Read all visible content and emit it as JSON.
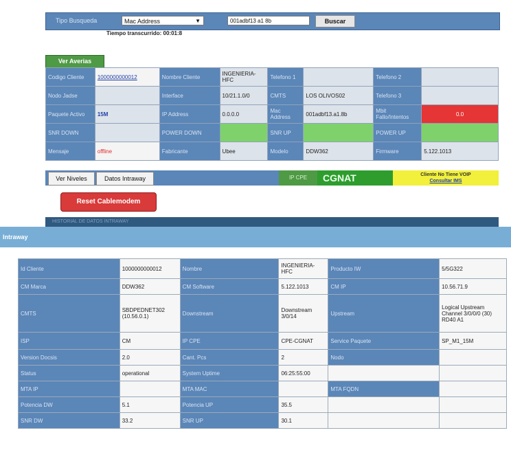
{
  "search": {
    "label": "Tipo Busqueda",
    "select_value": "Mac Address",
    "input_value": "001adbf13 a1 8b",
    "button": "Buscar",
    "elapsed": "Tiempo transcurrido: 00:01:8"
  },
  "tab_label": "Ver Averias",
  "grid": {
    "rows": [
      [
        {
          "t": "Codigo Cliente",
          "c": "lab"
        },
        {
          "t": "1000000000012",
          "c": "val-w link"
        },
        {
          "t": "Nombre Cliente",
          "c": "lab"
        },
        {
          "t": "INGENIERIA-HFC",
          "c": "val"
        },
        {
          "t": "Telefono 1",
          "c": "lab"
        },
        {
          "t": "",
          "c": "val"
        },
        {
          "t": "Telefono 2",
          "c": "lab"
        },
        {
          "t": "",
          "c": "val"
        }
      ],
      [
        {
          "t": "Nodo Jadse",
          "c": "lab"
        },
        {
          "t": "",
          "c": "val"
        },
        {
          "t": "Interface",
          "c": "lab"
        },
        {
          "t": "10/21.1.0/0",
          "c": "val"
        },
        {
          "t": "CMTS",
          "c": "lab"
        },
        {
          "t": "LOS OLIVOS02",
          "c": "val"
        },
        {
          "t": "Telefono 3",
          "c": "lab"
        },
        {
          "t": "",
          "c": "val"
        }
      ],
      [
        {
          "t": "Paquete Activo",
          "c": "lab"
        },
        {
          "t": "15M",
          "c": "val big-blue"
        },
        {
          "t": "IP Address",
          "c": "lab"
        },
        {
          "t": "0.0.0.0",
          "c": "val"
        },
        {
          "t": "Mac Address",
          "c": "lab"
        },
        {
          "t": "001adbf13.a1.8b",
          "c": "val"
        },
        {
          "t": "Mbit Fallo/Intentos",
          "c": "lab"
        },
        {
          "t": "0.0",
          "c": "red"
        }
      ],
      [
        {
          "t": "SNR DOWN",
          "c": "lab"
        },
        {
          "t": "",
          "c": "val"
        },
        {
          "t": "POWER DOWN",
          "c": "lab"
        },
        {
          "t": "",
          "c": "greenc"
        },
        {
          "t": "SNR UP",
          "c": "lab"
        },
        {
          "t": "",
          "c": "greenc"
        },
        {
          "t": "POWER UP",
          "c": "lab"
        },
        {
          "t": "",
          "c": "greenc"
        }
      ],
      [
        {
          "t": "Mensaje",
          "c": "lab"
        },
        {
          "t": "offline",
          "c": "val-w big-red"
        },
        {
          "t": "Fabricante",
          "c": "lab"
        },
        {
          "t": "Ubee",
          "c": "val"
        },
        {
          "t": "Modelo",
          "c": "lab"
        },
        {
          "t": "DDW362",
          "c": "val"
        },
        {
          "t": "Firmware",
          "c": "lab"
        },
        {
          "t": "5.122.1013",
          "c": "val"
        }
      ]
    ]
  },
  "actions": {
    "niveles": "Ver Niveles",
    "intraway": "Datos Intraway",
    "ipcpe": "IP CPE",
    "cgnat": "CGNAT",
    "voip_line1": "Cliente No Tiene VOIP",
    "voip_line2": "Consultar IMS",
    "reset": "Reset Cablemodem",
    "under": "HISTORIAL DE DATOS INTRAWAY"
  },
  "overlay_title": "Intraway",
  "intraway": {
    "rows": [
      [
        {
          "t": "Id Cliente",
          "c": "l"
        },
        {
          "t": "1000000000012",
          "c": "v"
        },
        {
          "t": "Nombre",
          "c": "l"
        },
        {
          "t": "INGENIERIA-HFC",
          "c": "v"
        },
        {
          "t": "Producto IW",
          "c": "l"
        },
        {
          "t": "5/5G322",
          "c": "v"
        }
      ],
      [
        {
          "t": "CM Marca",
          "c": "l"
        },
        {
          "t": "DDW362",
          "c": "v"
        },
        {
          "t": "CM Software",
          "c": "l"
        },
        {
          "t": "5.122.1013",
          "c": "v"
        },
        {
          "t": "CM IP",
          "c": "l"
        },
        {
          "t": "10.56.71.9",
          "c": "v"
        }
      ],
      [
        {
          "t": "CMTS",
          "c": "l"
        },
        {
          "t": "SBDPEDNET302 (10.56.0.1)",
          "c": "v"
        },
        {
          "t": "Downstream",
          "c": "l"
        },
        {
          "t": "Downstream 3/0/14",
          "c": "v"
        },
        {
          "t": "Upstream",
          "c": "l"
        },
        {
          "t": "Logical Upstream Channel 3/0/0/0 (30) RD40 A1",
          "c": "v"
        }
      ],
      [
        {
          "t": "ISP",
          "c": "l"
        },
        {
          "t": "CM",
          "c": "v"
        },
        {
          "t": "IP CPE",
          "c": "l"
        },
        {
          "t": "CPE-CGNAT",
          "c": "v"
        },
        {
          "t": "Service Paquete",
          "c": "l"
        },
        {
          "t": "SP_M1_15M",
          "c": "v"
        }
      ],
      [
        {
          "t": "Version Docsis",
          "c": "l"
        },
        {
          "t": "2.0",
          "c": "v"
        },
        {
          "t": "Cant. Pcs",
          "c": "l"
        },
        {
          "t": "2",
          "c": "v"
        },
        {
          "t": "Nodo",
          "c": "l"
        },
        {
          "t": "",
          "c": "v"
        }
      ],
      [
        {
          "t": "Status",
          "c": "l"
        },
        {
          "t": "operational",
          "c": "v"
        },
        {
          "t": "System Uptime",
          "c": "l"
        },
        {
          "t": "06:25:55:00",
          "c": "v"
        },
        {
          "t": "",
          "c": "v"
        },
        {
          "t": "",
          "c": "v"
        }
      ],
      [
        {
          "t": "MTA IP",
          "c": "l"
        },
        {
          "t": "",
          "c": "v"
        },
        {
          "t": "MTA MAC",
          "c": "l"
        },
        {
          "t": "",
          "c": "v"
        },
        {
          "t": "MTA FQDN",
          "c": "l"
        },
        {
          "t": "",
          "c": "v"
        }
      ],
      [
        {
          "t": "Potencia DW",
          "c": "l"
        },
        {
          "t": "5.1",
          "c": "v"
        },
        {
          "t": "Potencia UP",
          "c": "l"
        },
        {
          "t": "35.5",
          "c": "v"
        },
        {
          "t": "",
          "c": "v"
        },
        {
          "t": "",
          "c": "v"
        }
      ],
      [
        {
          "t": "SNR DW",
          "c": "l"
        },
        {
          "t": "33.2",
          "c": "v"
        },
        {
          "t": "SNR UP",
          "c": "l"
        },
        {
          "t": "30.1",
          "c": "v"
        },
        {
          "t": "",
          "c": "v"
        },
        {
          "t": "",
          "c": "v"
        }
      ]
    ]
  }
}
